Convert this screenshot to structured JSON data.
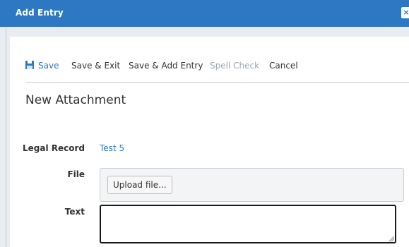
{
  "dialog": {
    "title": "Add Entry",
    "close_glyph": "×"
  },
  "toolbar": {
    "save_label": "Save",
    "save_exit_label": "Save & Exit",
    "save_add_label": "Save & Add Entry",
    "spell_check_label": "Spell Check",
    "cancel_label": "Cancel"
  },
  "form": {
    "heading": "New Attachment",
    "legal_record_label": "Legal Record",
    "legal_record_value": "Test 5",
    "file_label": "File",
    "upload_button_label": "Upload file...",
    "text_label": "Text",
    "text_value": ""
  },
  "colors": {
    "accent": "#2d77c3",
    "disabled": "#9aa5b4"
  },
  "icons": {
    "save": "floppy-disk-icon",
    "close": "close-icon",
    "resize": "resize-grip-icon"
  }
}
